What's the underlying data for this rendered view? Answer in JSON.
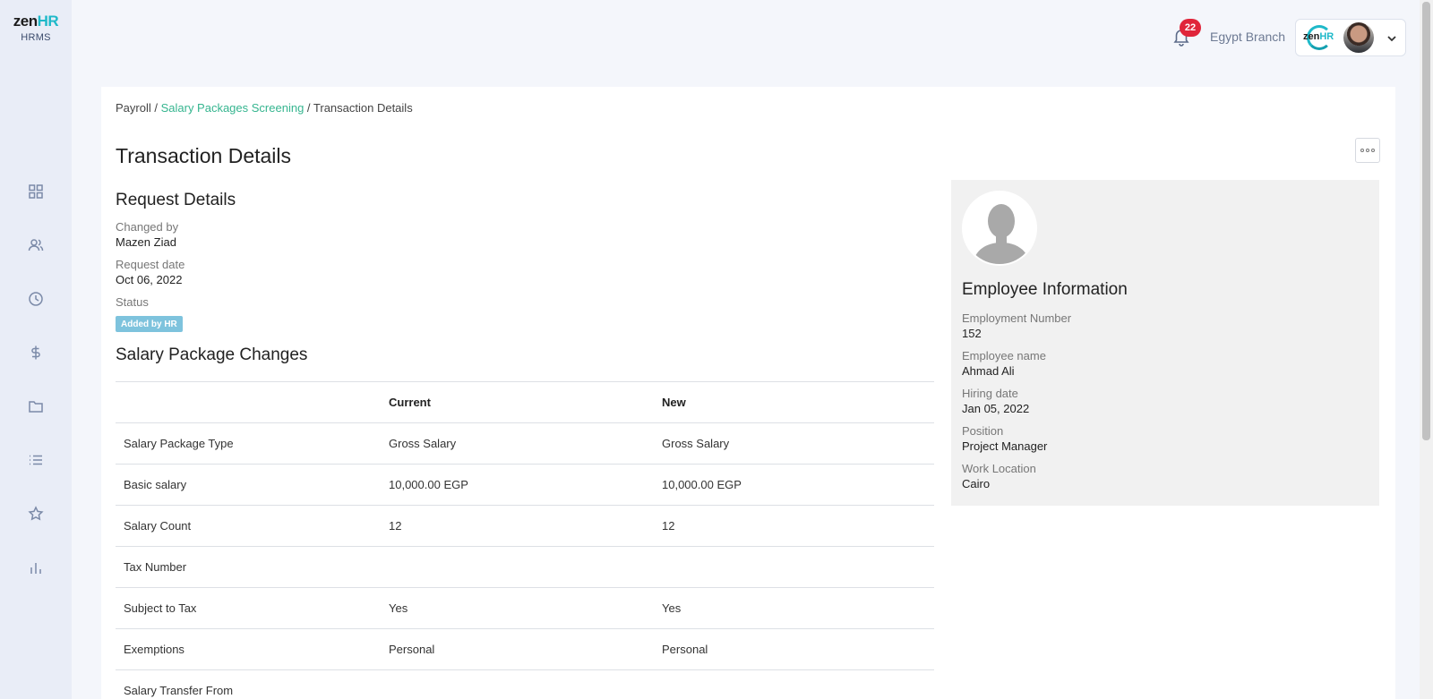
{
  "app": {
    "logo_main": "zen",
    "logo_accent": "HR",
    "logo_sub": "HRMS"
  },
  "sidebar": {
    "icons": [
      "dashboard-icon",
      "people-icon",
      "clock-icon",
      "dollar-icon",
      "folder-icon",
      "list-icon",
      "star-icon",
      "bar-chart-icon"
    ]
  },
  "topbar": {
    "notification_count": "22",
    "branch": "Egypt Branch",
    "user_logo_main": "zen",
    "user_logo_accent": "HR"
  },
  "breadcrumb": {
    "root": "Payroll",
    "sep1": " / ",
    "middle": "Salary Packages Screening",
    "sep2": " / ",
    "current": "Transaction Details"
  },
  "page": {
    "title": "Transaction Details"
  },
  "request": {
    "title": "Request Details",
    "changed_by_label": "Changed by",
    "changed_by": "Mazen Ziad",
    "request_date_label": "Request date",
    "request_date": "Oct 06, 2022",
    "status_label": "Status",
    "status": "Added by HR"
  },
  "changes": {
    "title": "Salary Package Changes",
    "headers": [
      "",
      "Current",
      "New"
    ],
    "rows": [
      [
        "Salary Package Type",
        "Gross Salary",
        "Gross Salary"
      ],
      [
        "Basic salary",
        "10,000.00 EGP",
        "10,000.00 EGP"
      ],
      [
        "Salary Count",
        "12",
        "12"
      ],
      [
        "Tax Number",
        "",
        ""
      ],
      [
        "Subject to Tax",
        "Yes",
        "Yes"
      ],
      [
        "Exemptions",
        "Personal",
        "Personal"
      ],
      [
        "Salary Transfer From",
        "",
        ""
      ]
    ]
  },
  "employee": {
    "title": "Employee Information",
    "employment_number_label": "Employment Number",
    "employment_number": "152",
    "name_label": "Employee name",
    "name": "Ahmad Ali",
    "hiring_date_label": "Hiring date",
    "hiring_date": "Jan 05, 2022",
    "position_label": "Position",
    "position": "Project Manager",
    "location_label": "Work Location",
    "location": "Cairo"
  },
  "colors": {
    "accent": "#35b58f",
    "brand": "#1fb9c9",
    "badge": "#e0253a",
    "status": "#7ec3dd"
  }
}
